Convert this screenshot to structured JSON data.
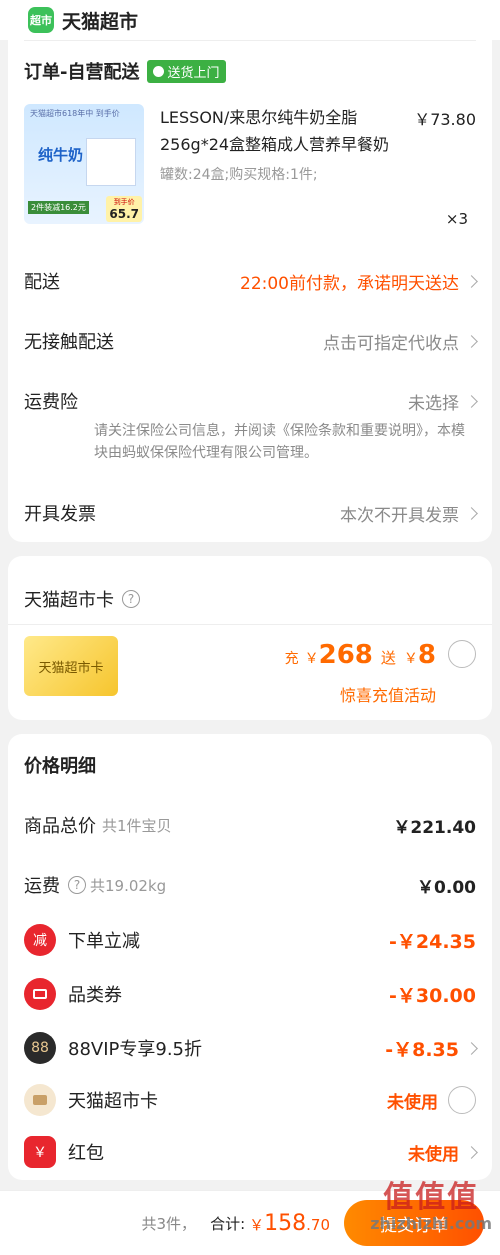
{
  "header": {
    "logo_text": "超市",
    "title": "天猫超市"
  },
  "order": {
    "title": "订单-自营配送",
    "badge": "送货上门",
    "product": {
      "image_texts": {
        "top": "天猫超市618年中 到手价",
        "brand": "纯牛奶",
        "promo": "2件装减16.2元",
        "price_label": "到手价",
        "price": "65.7"
      },
      "name": "LESSON/来思尔纯牛奶全脂256g*24盒整箱成人营养早餐奶",
      "spec": "罐数:24盒;购买规格:1件;",
      "price": "￥73.80",
      "qty": "×3"
    },
    "delivery": {
      "label": "配送",
      "value": "22:00前付款，承诺明天送达"
    },
    "contactless": {
      "label": "无接触配送",
      "value": "点击可指定代收点"
    },
    "insurance": {
      "label": "运费险",
      "value": "未选择",
      "note": "请关注保险公司信息，并阅读《保险条款和重要说明》，本模块由蚂蚁保保险代理有限公司管理。"
    },
    "invoice": {
      "label": "开具发票",
      "value": "本次不开具发票"
    }
  },
  "card": {
    "title": "天猫超市卡",
    "image_text": "天猫超市卡",
    "recharge_prefix": "充",
    "recharge_amount": "268",
    "gift_prefix": "送",
    "gift_amount": "8",
    "yen": "￥",
    "promo": "惊喜充值活动"
  },
  "price": {
    "title": "价格明细",
    "total": {
      "label": "商品总价",
      "sub": "共1件宝贝",
      "value": "￥221.40"
    },
    "shipping": {
      "label": "运费",
      "sub": "共19.02kg",
      "value": "￥0.00"
    },
    "instant": {
      "icon": "减",
      "label": "下单立减",
      "value": "-￥24.35"
    },
    "coupon": {
      "label": "品类券",
      "value": "-￥30.00"
    },
    "vip": {
      "icon": "88",
      "label": "88VIP专享9.5折",
      "value": "-￥8.35"
    },
    "supercard": {
      "label": "天猫超市卡",
      "value": "未使用"
    },
    "redpacket": {
      "icon": "￥",
      "label": "红包",
      "value": "未使用"
    }
  },
  "footer": {
    "count": "共3件，",
    "total_label": "合计:",
    "yen": "￥",
    "total_int": "158",
    "total_dec": ".70",
    "submit": "提交订单"
  },
  "watermark": {
    "text": "值值值",
    "url": "zhizhizhi.com"
  }
}
